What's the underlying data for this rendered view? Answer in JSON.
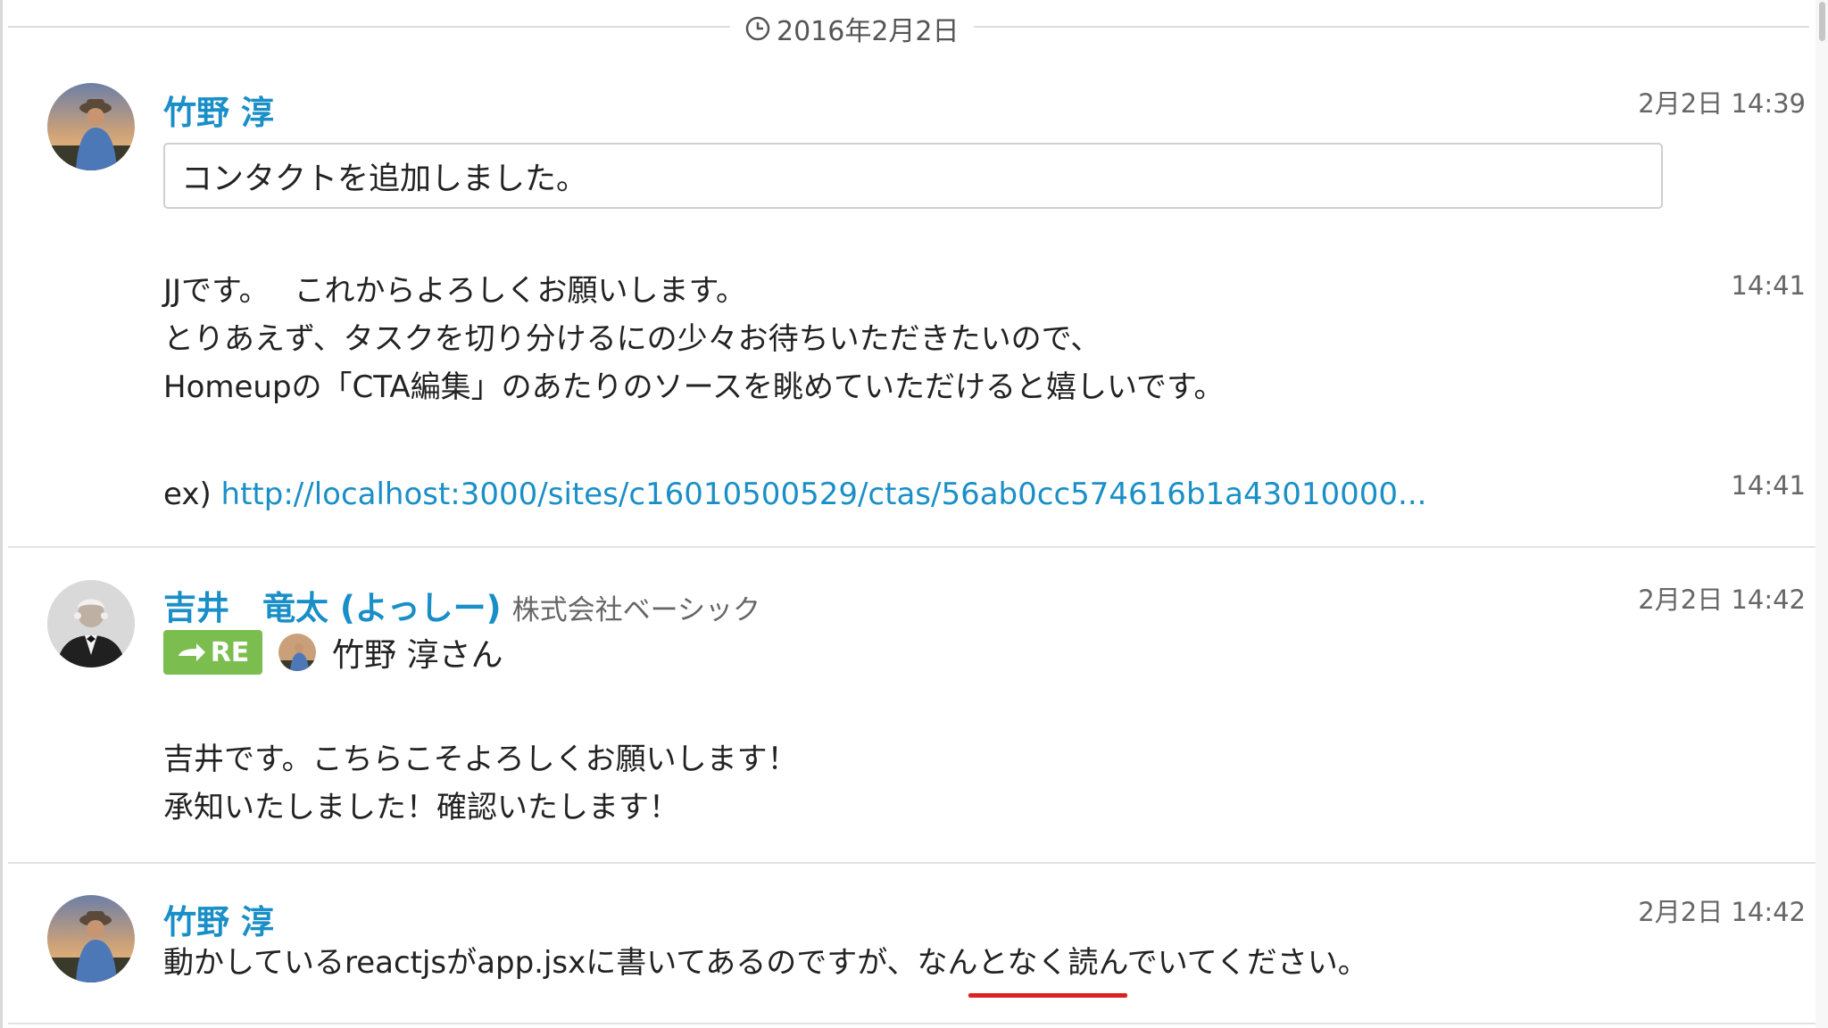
{
  "date_divider": {
    "label": "2016年2月2日",
    "icon": "clock-icon"
  },
  "messages": [
    {
      "sender": "竹野 淳",
      "avatar": "avatar-takeno",
      "timestamp": "2月2日 14:39",
      "quote": "コンタクトを追加しました。",
      "blocks": [
        {
          "lines": [
            "JJです。　 これからよろしくお願いします。",
            "とりあえず、タスクを切り分けるにの少々お待ちいただきたいので、",
            "Homeupの「CTA編集」のあたりのソースを眺めていただけると嬉しいです。"
          ],
          "time": "14:41"
        },
        {
          "prefix": "ex)",
          "link": "http://localhost:3000/sites/c16010500529/ctas/56ab0cc574616b1a43010000...",
          "time": "14:41"
        }
      ]
    },
    {
      "sender": "吉井　竜太 (よっしー)",
      "org": "株式会社ベーシック",
      "avatar": "avatar-yoshii",
      "timestamp": "2月2日 14:42",
      "reply": {
        "badge": "RE",
        "to": "竹野 淳さん",
        "icon": "reply-arrow-icon"
      },
      "lines": [
        "吉井です。こちらこそよろしくお願いします！",
        "承知いたしました！確認いたします！"
      ]
    },
    {
      "sender": "竹野 淳",
      "avatar": "avatar-takeno",
      "timestamp": "2月2日 14:42",
      "lines": [
        "動かしているreactjsがapp.jsxに書いてあるのですが、なんとなく読んでいてください。"
      ]
    }
  ],
  "colors": {
    "sender": "#1a8fc7",
    "link": "#1a8fc7",
    "re_badge": "#7bbd4f",
    "annotation_underline": "#e02020"
  }
}
